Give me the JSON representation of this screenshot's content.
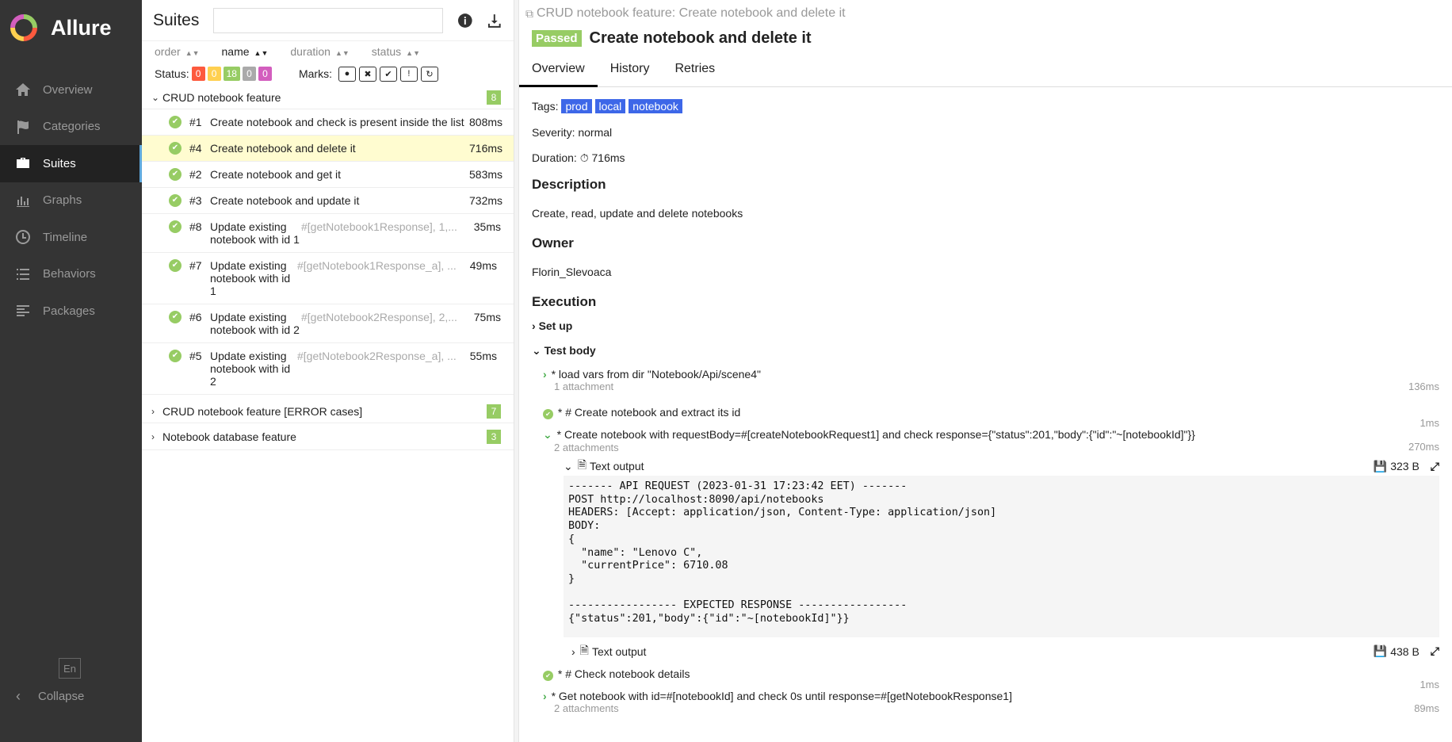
{
  "sidebar": {
    "brand": "Allure",
    "items": [
      {
        "label": "Overview",
        "icon": "home-icon"
      },
      {
        "label": "Categories",
        "icon": "flag-icon"
      },
      {
        "label": "Suites",
        "icon": "briefcase-icon"
      },
      {
        "label": "Graphs",
        "icon": "bar-chart-icon"
      },
      {
        "label": "Timeline",
        "icon": "clock-icon"
      },
      {
        "label": "Behaviors",
        "icon": "list-icon"
      },
      {
        "label": "Packages",
        "icon": "align-left-icon"
      }
    ],
    "language": "En",
    "collapse_label": "Collapse",
    "active_item": "Suites",
    "accent_color": "#5fa9dd"
  },
  "suites": {
    "title": "Suites",
    "sorters": [
      "order",
      "name",
      "duration",
      "status"
    ],
    "status_label": "Status:",
    "status_counts": [
      {
        "value": "0",
        "color": "#fd5a3e"
      },
      {
        "value": "0",
        "color": "#ffd050"
      },
      {
        "value": "18",
        "color": "#97cc64"
      },
      {
        "value": "0",
        "color": "#aaaaaa"
      },
      {
        "value": "0",
        "color": "#d35ebe"
      }
    ],
    "marks_label": "Marks:",
    "groups": [
      {
        "name": "CRUD notebook feature",
        "count": "8"
      },
      {
        "name": "CRUD notebook feature [ERROR cases]",
        "count": "7"
      },
      {
        "name": "Notebook database feature",
        "count": "3"
      }
    ],
    "rows": [
      {
        "num": "#1",
        "name": "Create notebook and check is present inside the list",
        "param": "",
        "duration": "808ms"
      },
      {
        "num": "#4",
        "name": "Create notebook and delete it",
        "param": "",
        "duration": "716ms"
      },
      {
        "num": "#2",
        "name": "Create notebook and get it",
        "param": "",
        "duration": "583ms"
      },
      {
        "num": "#3",
        "name": "Create notebook and update it",
        "param": "",
        "duration": "732ms"
      },
      {
        "num": "#8",
        "name": "Update existing notebook with id 1",
        "param": "#[getNotebook1Response], 1,...",
        "duration": "35ms"
      },
      {
        "num": "#7",
        "name": "Update existing notebook with id 1",
        "param": "#[getNotebook1Response_a], ...",
        "duration": "49ms"
      },
      {
        "num": "#6",
        "name": "Update existing notebook with id 2",
        "param": "#[getNotebook2Response], 2,...",
        "duration": "75ms"
      },
      {
        "num": "#5",
        "name": "Update existing notebook with id 2",
        "param": "#[getNotebook2Response_a], ...",
        "duration": "55ms"
      }
    ]
  },
  "details": {
    "breadcrumb": "CRUD notebook feature: Create notebook and delete it",
    "status": "Passed",
    "title": "Create notebook and delete it",
    "tabs": [
      "Overview",
      "History",
      "Retries"
    ],
    "tags_label": "Tags:",
    "tags": [
      "prod",
      "local",
      "notebook"
    ],
    "severity": "Severity: normal",
    "duration_label": "Duration:",
    "duration": "716ms",
    "description_heading": "Description",
    "description": "Create, read, update and delete notebooks",
    "owner_heading": "Owner",
    "owner": "Florin_Slevoaca",
    "execution_heading": "Execution",
    "setup_label": "Set up",
    "testbody_label": "Test body",
    "steps": {
      "s1": {
        "text": "* load vars from dir \"Notebook/Api/scene4\"",
        "sub": "1 attachment",
        "duration": "136ms"
      },
      "s2": {
        "text": "* # Create notebook and extract its id",
        "duration": "1ms"
      },
      "s3": {
        "text": "* Create notebook with requestBody=#[createNotebookRequest1] and check response={\"status\":201,\"body\":{\"id\":\"~[notebookId]\"}}",
        "sub": "2 attachments",
        "duration": "270ms"
      },
      "s4": {
        "text": "* # Check notebook details",
        "duration": "1ms"
      },
      "s5": {
        "text": "* Get notebook with id=#[notebookId] and check 0s until response=#[getNotebookResponse1]",
        "sub": "2 attachments",
        "duration": "89ms"
      }
    },
    "attachment1": {
      "label": "Text output",
      "size": "323 B"
    },
    "attachment2": {
      "label": "Text output",
      "size": "438 B"
    },
    "code": "------- API REQUEST (2023-01-31 17:23:42 EET) -------\nPOST http://localhost:8090/api/notebooks\nHEADERS: [Accept: application/json, Content-Type: application/json]\nBODY:\n{\n  \"name\": \"Lenovo C\",\n  \"currentPrice\": 6710.08\n}\n\n----------------- EXPECTED RESPONSE -----------------\n{\"status\":201,\"body\":{\"id\":\"~[notebookId]\"}}",
    "passed_color": "#97cc64",
    "tag_color": "#3d67e8"
  }
}
